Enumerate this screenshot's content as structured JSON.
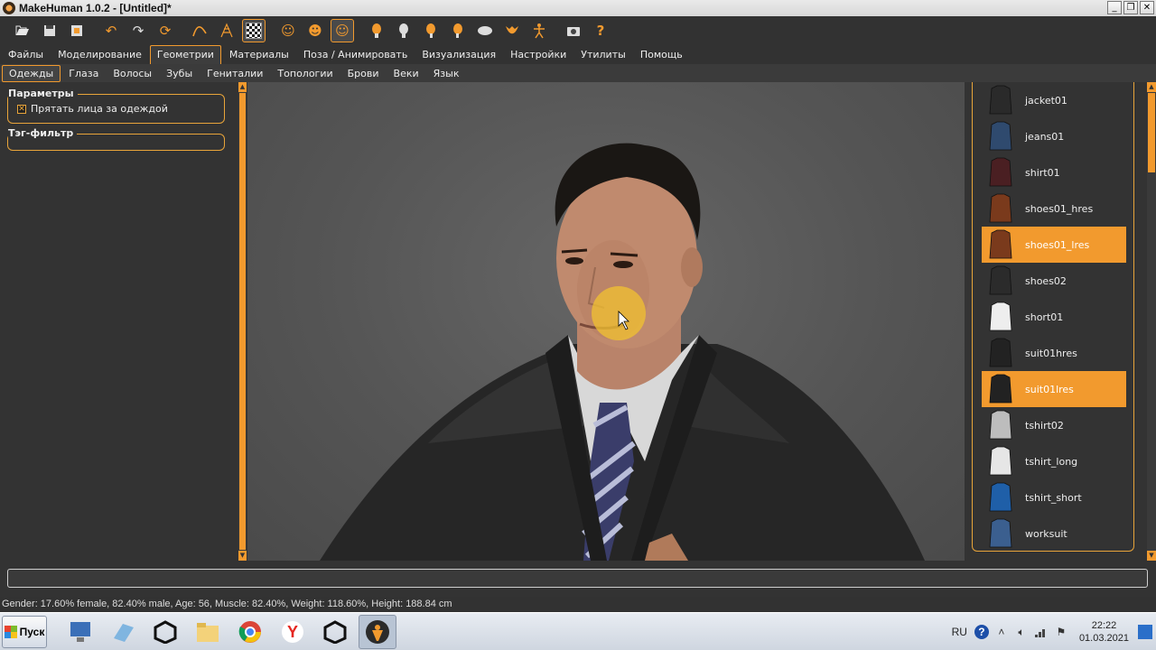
{
  "window": {
    "title": "MakeHuman 1.0.2 - [Untitled]*",
    "buttons": [
      "_",
      "❐",
      "✕"
    ]
  },
  "toolbar": {
    "icons": [
      "open-icon",
      "save-icon",
      "export-icon",
      "undo-icon",
      "redo-icon",
      "reset-icon",
      "smooth-icon",
      "wireframe-icon",
      "background-icon",
      "pose-front-icon",
      "pose-back-icon",
      "pose-side-icon",
      "view-front-icon",
      "view-back-icon",
      "view-left-icon",
      "view-right-icon",
      "view-top-icon",
      "view-bottom-icon",
      "skeleton-icon",
      "screenshot-icon",
      "help-icon"
    ]
  },
  "main_tabs": [
    "Файлы",
    "Моделирование",
    "Геометрии",
    "Материалы",
    "Поза / Анимировать",
    "Визуализация",
    "Настройки",
    "Утилиты",
    "Помощь"
  ],
  "main_tab_active": "Геометрии",
  "sub_tabs": [
    "Одежды",
    "Глаза",
    "Волосы",
    "Зубы",
    "Гениталии",
    "Топологии",
    "Брови",
    "Веки",
    "Язык"
  ],
  "sub_tab_active": "Одежды",
  "left_panel": {
    "params_title": "Параметры",
    "hide_faces_label": "Прятать лица за одеждой",
    "hide_faces_checked": true,
    "tag_filter_title": "Тэг-фильтр"
  },
  "clothes": [
    {
      "label": "jacket01",
      "selected": false,
      "color": "#2a2a2a"
    },
    {
      "label": "jeans01",
      "selected": false,
      "color": "#2f4a6e"
    },
    {
      "label": "shirt01",
      "selected": false,
      "color": "#4a1f22"
    },
    {
      "label": "shoes01_hres",
      "selected": false,
      "color": "#7a3a1c"
    },
    {
      "label": "shoes01_lres",
      "selected": true,
      "color": "#7a3a1c"
    },
    {
      "label": "shoes02",
      "selected": false,
      "color": "#2b2b2b"
    },
    {
      "label": "short01",
      "selected": false,
      "color": "#eeeeee"
    },
    {
      "label": "suit01hres",
      "selected": false,
      "color": "#222222"
    },
    {
      "label": "suit01lres",
      "selected": true,
      "color": "#222222"
    },
    {
      "label": "tshirt02",
      "selected": false,
      "color": "#bdbdbd"
    },
    {
      "label": "tshirt_long",
      "selected": false,
      "color": "#e6e6e6"
    },
    {
      "label": "tshirt_short",
      "selected": false,
      "color": "#1f5fa8"
    },
    {
      "label": "worksuit",
      "selected": false,
      "color": "#3b5f8f"
    }
  ],
  "status_bar": {
    "text": "Gender: 17.60% female, 82.40% male, Age: 56, Muscle: 82.40%, Weight: 118.60%, Height: 188.84 cm"
  },
  "taskbar": {
    "start_label": "Пуск",
    "apps": [
      "computer-icon",
      "notepad-icon",
      "unity-icon",
      "explorer-icon",
      "chrome-icon",
      "yandex-icon",
      "unity-icon",
      "makehuman-icon"
    ],
    "lang": "RU",
    "time": "22:22",
    "date": "01.03.2021"
  },
  "colors": {
    "accent": "#f29a2e",
    "panel_bg": "#333333"
  }
}
